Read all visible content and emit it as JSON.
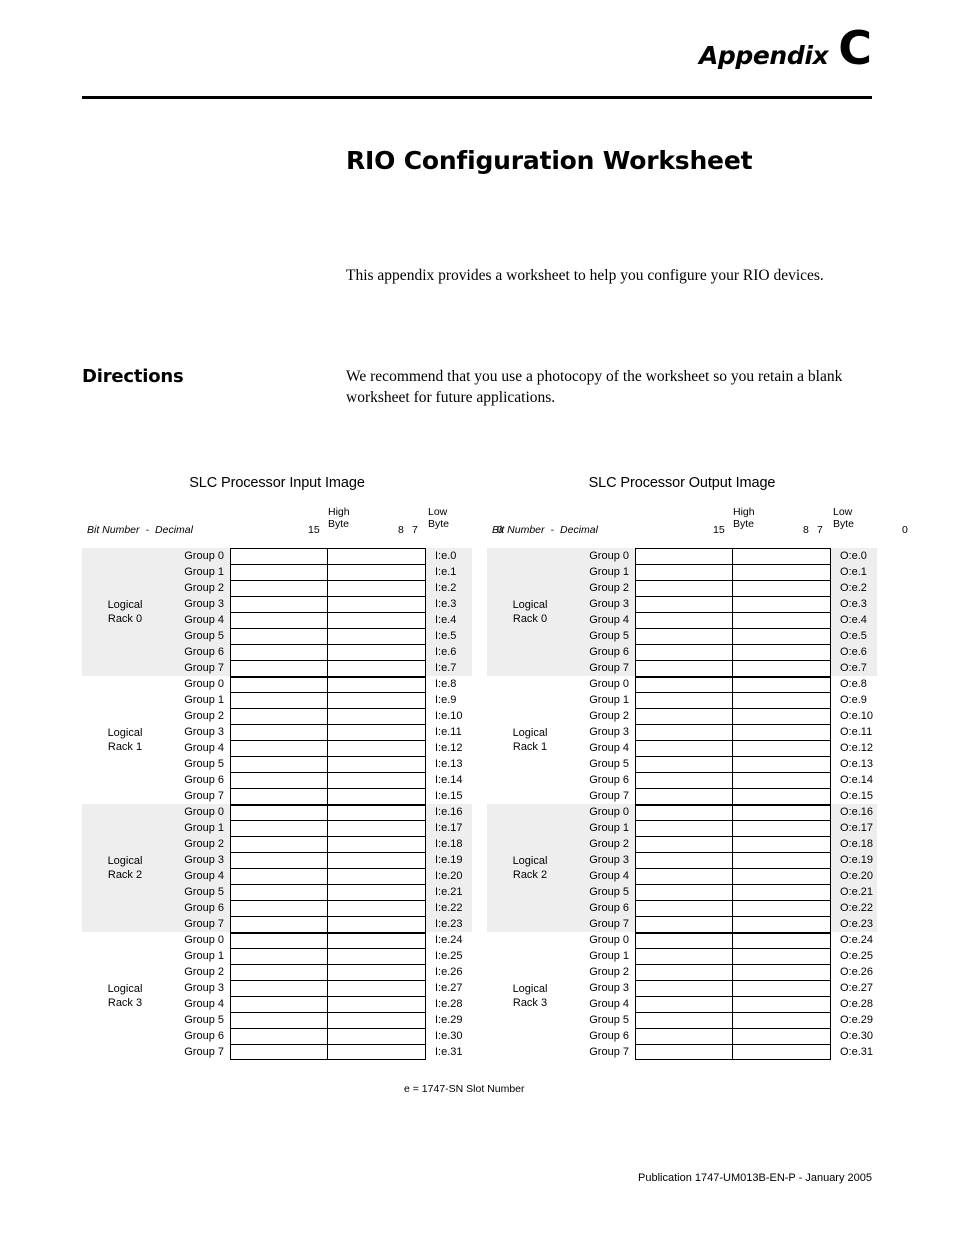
{
  "header": {
    "appendix_word": "Appendix",
    "appendix_letter": "C"
  },
  "title": "RIO Configuration Worksheet",
  "intro_paragraph": "This appendix provides a worksheet to help you configure your RIO devices.",
  "directions": {
    "heading": "Directions",
    "paragraph": "We recommend that you use a photocopy of the worksheet so you retain a blank worksheet for future applications."
  },
  "worksheets": [
    {
      "id": "input",
      "title": "SLC Processor Input Image",
      "high_byte_label": "High Byte",
      "low_byte_label": "Low Byte",
      "bit_number_label": "Bit Number",
      "bit_number_separator": "-",
      "bit_number_radix": "Decimal",
      "bit_ticks": {
        "msb": "15",
        "high_lsb": "8",
        "low_msb": "7",
        "lsb": "0"
      },
      "racks": [
        {
          "label_line1": "Logical",
          "label_line2": "Rack 0",
          "shaded": true,
          "rows": [
            {
              "group": "Group 0",
              "address": "I:e.0"
            },
            {
              "group": "Group 1",
              "address": "I:e.1"
            },
            {
              "group": "Group 2",
              "address": "I:e.2"
            },
            {
              "group": "Group 3",
              "address": "I:e.3"
            },
            {
              "group": "Group 4",
              "address": "I:e.4"
            },
            {
              "group": "Group 5",
              "address": "I:e.5"
            },
            {
              "group": "Group 6",
              "address": "I:e.6"
            },
            {
              "group": "Group 7",
              "address": "I:e.7"
            }
          ]
        },
        {
          "label_line1": "Logical",
          "label_line2": "Rack 1",
          "shaded": false,
          "rows": [
            {
              "group": "Group 0",
              "address": "I:e.8"
            },
            {
              "group": "Group 1",
              "address": "I:e.9"
            },
            {
              "group": "Group 2",
              "address": "I:e.10"
            },
            {
              "group": "Group 3",
              "address": "I:e.11"
            },
            {
              "group": "Group 4",
              "address": "I:e.12"
            },
            {
              "group": "Group 5",
              "address": "I:e.13"
            },
            {
              "group": "Group 6",
              "address": "I:e.14"
            },
            {
              "group": "Group 7",
              "address": "I:e.15"
            }
          ]
        },
        {
          "label_line1": "Logical",
          "label_line2": "Rack 2",
          "shaded": true,
          "rows": [
            {
              "group": "Group 0",
              "address": "I:e.16"
            },
            {
              "group": "Group 1",
              "address": "I:e.17"
            },
            {
              "group": "Group 2",
              "address": "I:e.18"
            },
            {
              "group": "Group 3",
              "address": "I:e.19"
            },
            {
              "group": "Group 4",
              "address": "I:e.20"
            },
            {
              "group": "Group 5",
              "address": "I:e.21"
            },
            {
              "group": "Group 6",
              "address": "I:e.22"
            },
            {
              "group": "Group 7",
              "address": "I:e.23"
            }
          ]
        },
        {
          "label_line1": "Logical",
          "label_line2": "Rack 3",
          "shaded": false,
          "rows": [
            {
              "group": "Group 0",
              "address": "I:e.24"
            },
            {
              "group": "Group 1",
              "address": "I:e.25"
            },
            {
              "group": "Group 2",
              "address": "I:e.26"
            },
            {
              "group": "Group 3",
              "address": "I:e.27"
            },
            {
              "group": "Group 4",
              "address": "I:e.28"
            },
            {
              "group": "Group 5",
              "address": "I:e.29"
            },
            {
              "group": "Group 6",
              "address": "I:e.30"
            },
            {
              "group": "Group 7",
              "address": "I:e.31"
            }
          ]
        }
      ]
    },
    {
      "id": "output",
      "title": "SLC Processor Output Image",
      "high_byte_label": "High Byte",
      "low_byte_label": "Low Byte",
      "bit_number_label": "Bit Number",
      "bit_number_separator": "-",
      "bit_number_radix": "Decimal",
      "bit_ticks": {
        "msb": "15",
        "high_lsb": "8",
        "low_msb": "7",
        "lsb": "0"
      },
      "racks": [
        {
          "label_line1": "Logical",
          "label_line2": "Rack 0",
          "shaded": true,
          "rows": [
            {
              "group": "Group 0",
              "address": "O:e.0"
            },
            {
              "group": "Group 1",
              "address": "O:e.1"
            },
            {
              "group": "Group 2",
              "address": "O:e.2"
            },
            {
              "group": "Group 3",
              "address": "O:e.3"
            },
            {
              "group": "Group 4",
              "address": "O:e.4"
            },
            {
              "group": "Group 5",
              "address": "O:e.5"
            },
            {
              "group": "Group 6",
              "address": "O:e.6"
            },
            {
              "group": "Group 7",
              "address": "O:e.7"
            }
          ]
        },
        {
          "label_line1": "Logical",
          "label_line2": "Rack 1",
          "shaded": false,
          "rows": [
            {
              "group": "Group 0",
              "address": "O:e.8"
            },
            {
              "group": "Group 1",
              "address": "O:e.9"
            },
            {
              "group": "Group 2",
              "address": "O:e.10"
            },
            {
              "group": "Group 3",
              "address": "O:e.11"
            },
            {
              "group": "Group 4",
              "address": "O:e.12"
            },
            {
              "group": "Group 5",
              "address": "O:e.13"
            },
            {
              "group": "Group 6",
              "address": "O:e.14"
            },
            {
              "group": "Group 7",
              "address": "O:e.15"
            }
          ]
        },
        {
          "label_line1": "Logical",
          "label_line2": "Rack 2",
          "shaded": true,
          "rows": [
            {
              "group": "Group 0",
              "address": "O:e.16"
            },
            {
              "group": "Group 1",
              "address": "O:e.17"
            },
            {
              "group": "Group 2",
              "address": "O:e.18"
            },
            {
              "group": "Group 3",
              "address": "O:e.19"
            },
            {
              "group": "Group 4",
              "address": "O:e.20"
            },
            {
              "group": "Group 5",
              "address": "O:e.21"
            },
            {
              "group": "Group 6",
              "address": "O:e.22"
            },
            {
              "group": "Group 7",
              "address": "O:e.23"
            }
          ]
        },
        {
          "label_line1": "Logical",
          "label_line2": "Rack 3",
          "shaded": false,
          "rows": [
            {
              "group": "Group 0",
              "address": "O:e.24"
            },
            {
              "group": "Group 1",
              "address": "O:e.25"
            },
            {
              "group": "Group 2",
              "address": "O:e.26"
            },
            {
              "group": "Group 3",
              "address": "O:e.27"
            },
            {
              "group": "Group 4",
              "address": "O:e.28"
            },
            {
              "group": "Group 5",
              "address": "O:e.29"
            },
            {
              "group": "Group 6",
              "address": "O:e.30"
            },
            {
              "group": "Group 7",
              "address": "O:e.31"
            }
          ]
        }
      ]
    }
  ],
  "worksheet_footnote": "e = 1747-SN Slot Number",
  "page_footer": "Publication 1747-UM013B-EN-P - January 2005",
  "colors": {
    "shaded_band": "#eeeeee",
    "rule": "#000000",
    "text": "#000000"
  }
}
